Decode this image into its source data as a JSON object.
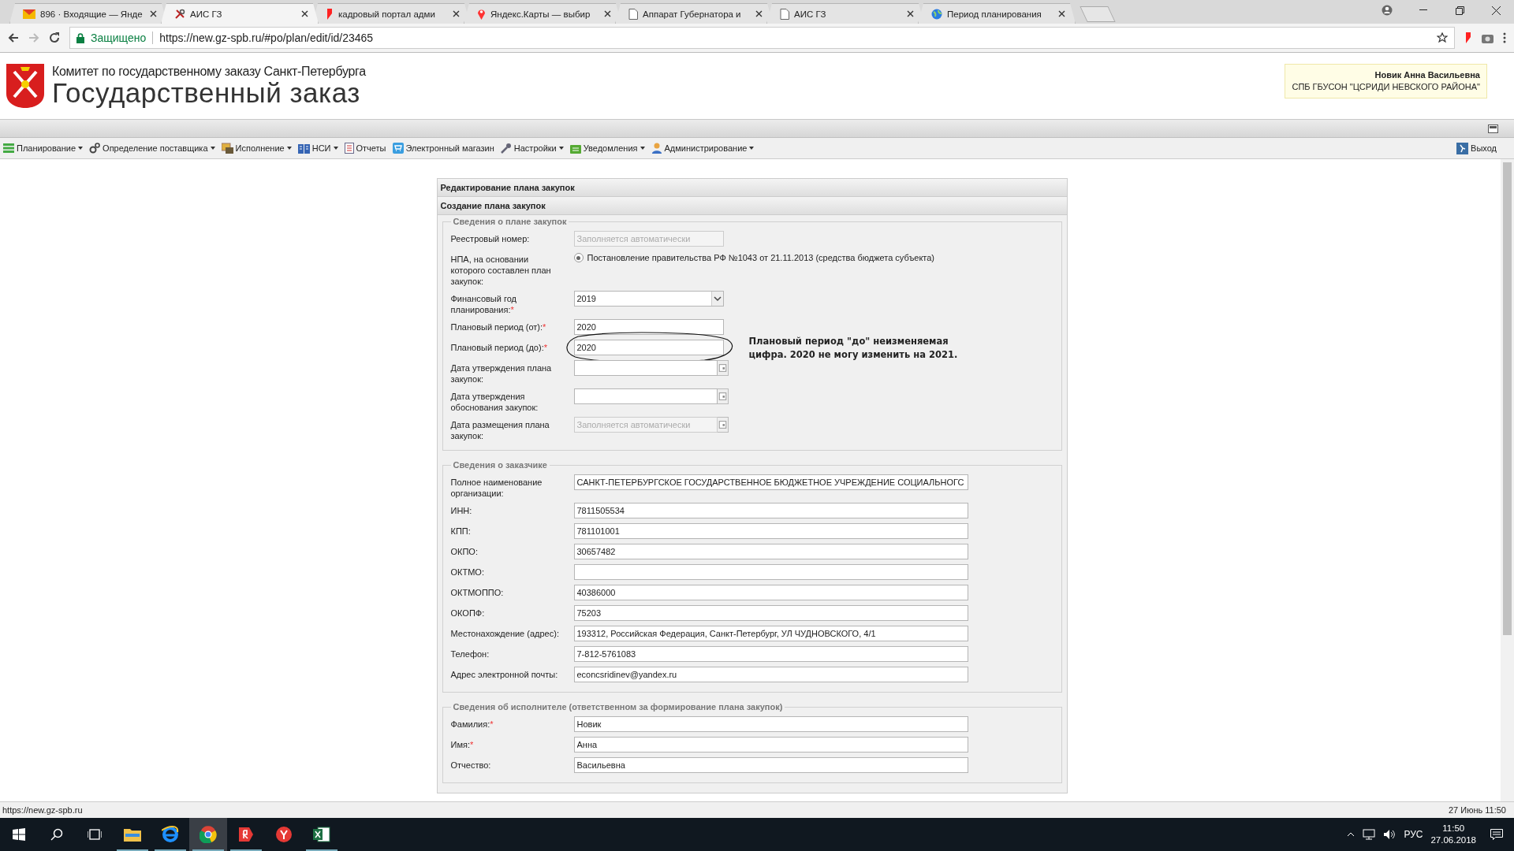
{
  "browser": {
    "tabs": [
      {
        "title": "896 · Входящие — Янде",
        "selected": false
      },
      {
        "title": "АИС ГЗ",
        "selected": true
      },
      {
        "title": "кадровый портал адми",
        "selected": false
      },
      {
        "title": "Яндекс.Карты — выбир",
        "selected": false
      },
      {
        "title": "Аппарат Губернатора и",
        "selected": false
      },
      {
        "title": "АИС ГЗ",
        "selected": false
      },
      {
        "title": "Период планирования",
        "selected": false
      }
    ],
    "address": {
      "secure_label": "Защищено",
      "url": "https://new.gz-spb.ru/#po/plan/edit/id/23465"
    }
  },
  "header": {
    "subtitle": "Комитет по государственному заказу Санкт-Петербурга",
    "title": "Государственный заказ"
  },
  "user": {
    "name": "Новик Анна Васильевна",
    "org": "СПБ ГБУСОН \"ЦСРИДИ НЕВСКОГО РАЙОНА\""
  },
  "menu": [
    {
      "label": "Планирование",
      "dropdown": true
    },
    {
      "label": "Определение поставщика",
      "dropdown": true
    },
    {
      "label": "Исполнение",
      "dropdown": true
    },
    {
      "label": "НСИ",
      "dropdown": true
    },
    {
      "label": "Отчеты",
      "dropdown": false
    },
    {
      "label": "Электронный магазин",
      "dropdown": false
    },
    {
      "label": "Настройки",
      "dropdown": true
    },
    {
      "label": "Уведомления",
      "dropdown": true
    },
    {
      "label": "Администрирование",
      "dropdown": true
    }
  ],
  "exit_label": "Выход",
  "form": {
    "title": "Редактирование плана закупок",
    "subtitle": "Создание плана закупок",
    "sections": [
      {
        "legend": "Сведения о плане закупок",
        "fields": [
          {
            "label": "Реестровый номер:",
            "kind": "text",
            "placeholder": "Заполняется автоматически",
            "disabled": true
          },
          {
            "label": "НПА, на основании которого составлен план закупок:",
            "kind": "radio",
            "option": "Постановление правительства РФ №1043 от 21.11.2013 (средства бюджета субъекта)",
            "selected": true
          },
          {
            "label": "Финансовый год планирования:",
            "required_mark": "*",
            "kind": "select",
            "value": "2019"
          },
          {
            "label": "Плановый период (от):",
            "required_mark": "*",
            "kind": "text",
            "value": "2020"
          },
          {
            "label": "Плановый период (до):",
            "required_mark": "*",
            "kind": "text",
            "value": "2020",
            "circled": true,
            "annotation": "Плановый период \"до\" неизменяемая цифра. 2020 не могу изменить на 2021."
          },
          {
            "label": "Дата утверждения плана закупок:",
            "kind": "date"
          },
          {
            "label": "Дата утверждения обоснования закупок:",
            "kind": "date"
          },
          {
            "label": "Дата размещения плана закупок:",
            "kind": "date",
            "placeholder": "Заполняется автоматически",
            "disabled": true
          }
        ]
      },
      {
        "legend": "Сведения о заказчике",
        "fields": [
          {
            "label": "Полное наименование организации:",
            "kind": "wide",
            "value": "САНКТ-ПЕТЕРБУРГСКОЕ ГОСУДАРСТВЕННОЕ БЮДЖЕТНОЕ УЧРЕЖДЕНИЕ СОЦИАЛЬНОГС"
          },
          {
            "label": "ИНН:",
            "kind": "wide",
            "value": "7811505534"
          },
          {
            "label": "КПП:",
            "kind": "wide",
            "value": "781101001"
          },
          {
            "label": "ОКПО:",
            "kind": "wide",
            "value": "30657482"
          },
          {
            "label": "ОКТМО:",
            "kind": "wide"
          },
          {
            "label": "ОКТМОППО:",
            "kind": "wide",
            "value": "40386000"
          },
          {
            "label": "ОКОПФ:",
            "kind": "wide",
            "value": "75203"
          },
          {
            "label": "Местонахождение (адрес):",
            "kind": "wide",
            "value": "193312, Российская Федерация, Санкт-Петербург, УЛ ЧУДНОВСКОГО, 4/1"
          },
          {
            "label": "Телефон:",
            "kind": "wide",
            "value": "7-812-5761083"
          },
          {
            "label": "Адрес электронной почты:",
            "kind": "wide",
            "value": "econcsridinev@yandex.ru"
          }
        ]
      },
      {
        "legend": "Сведения об исполнителе (ответственном за формирование плана закупок)",
        "fields": [
          {
            "label": "Фамилия:",
            "required_mark": "*",
            "kind": "wide",
            "value": "Новик"
          },
          {
            "label": "Имя:",
            "required_mark": "*",
            "kind": "wide",
            "value": "Анна"
          },
          {
            "label": "Отчество:",
            "kind": "wide",
            "value": "Васильевна"
          }
        ]
      }
    ]
  },
  "status_url": "https://new.gz-spb.ru",
  "status_clock": "27 Июнь 11:50",
  "taskbar": {
    "lang": "РУС",
    "time": "11:50",
    "date": "27.06.2018"
  }
}
